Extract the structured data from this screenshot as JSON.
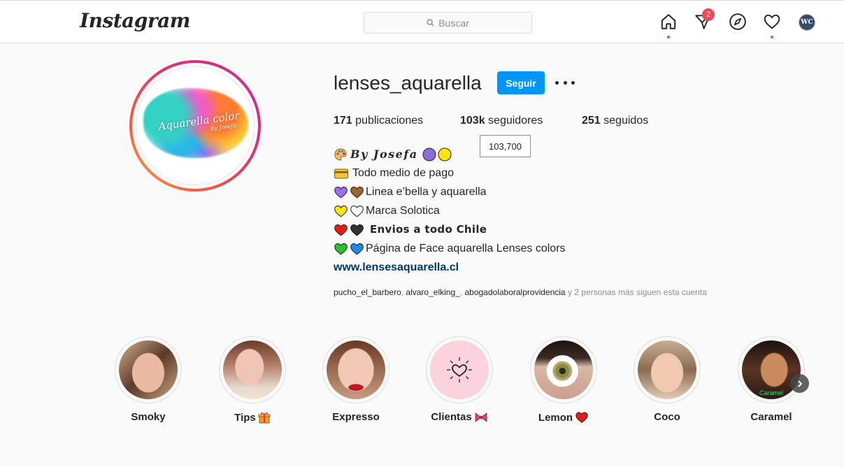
{
  "nav": {
    "logo": "Instagram",
    "search_placeholder": "Buscar",
    "direct_badge": "2",
    "avatar_initials": "WC"
  },
  "profile": {
    "username": "lenses_aquarella",
    "follow_label": "Seguir",
    "pic_brand": "Aquarella color",
    "pic_brand_sub": "By Josefa",
    "stats": {
      "posts_count": "171",
      "posts_label": "publicaciones",
      "followers_count": "103k",
      "followers_label": "seguidores",
      "following_count": "251",
      "following_label": "seguidos"
    },
    "followers_tooltip": "103,700",
    "bio": {
      "line1": "By Josefa",
      "line2": "Todo medio de pago",
      "line3": "Linea e’bella y aquarella",
      "line4": "Marca Solotica",
      "line5": "Envios a todo Chile",
      "line6": "Página de Face aquarella Lenses colors",
      "link": "www.lensesaquarella.cl"
    },
    "followed_by": {
      "user1": "pucho_el_barbero",
      "user2": "alvaro_elking_",
      "user3": "abogadolaboralprovidencia",
      "suffix": "y 2 personas más siguen esta cuenta"
    }
  },
  "highlights": [
    {
      "label": "Smoky",
      "emoji": ""
    },
    {
      "label": "Tips",
      "emoji": "gift-icon"
    },
    {
      "label": "Expresso",
      "emoji": ""
    },
    {
      "label": "Clientas",
      "emoji": "ribbon-icon"
    },
    {
      "label": "Lemon",
      "emoji": "red-heart-icon"
    },
    {
      "label": "Coco",
      "emoji": ""
    },
    {
      "label": "Caramel",
      "emoji": ""
    }
  ],
  "highlight_overlay_text": "Caramel",
  "colors": {
    "accent": "#0095f6",
    "link": "#00376b",
    "notification": "#ed4956"
  }
}
